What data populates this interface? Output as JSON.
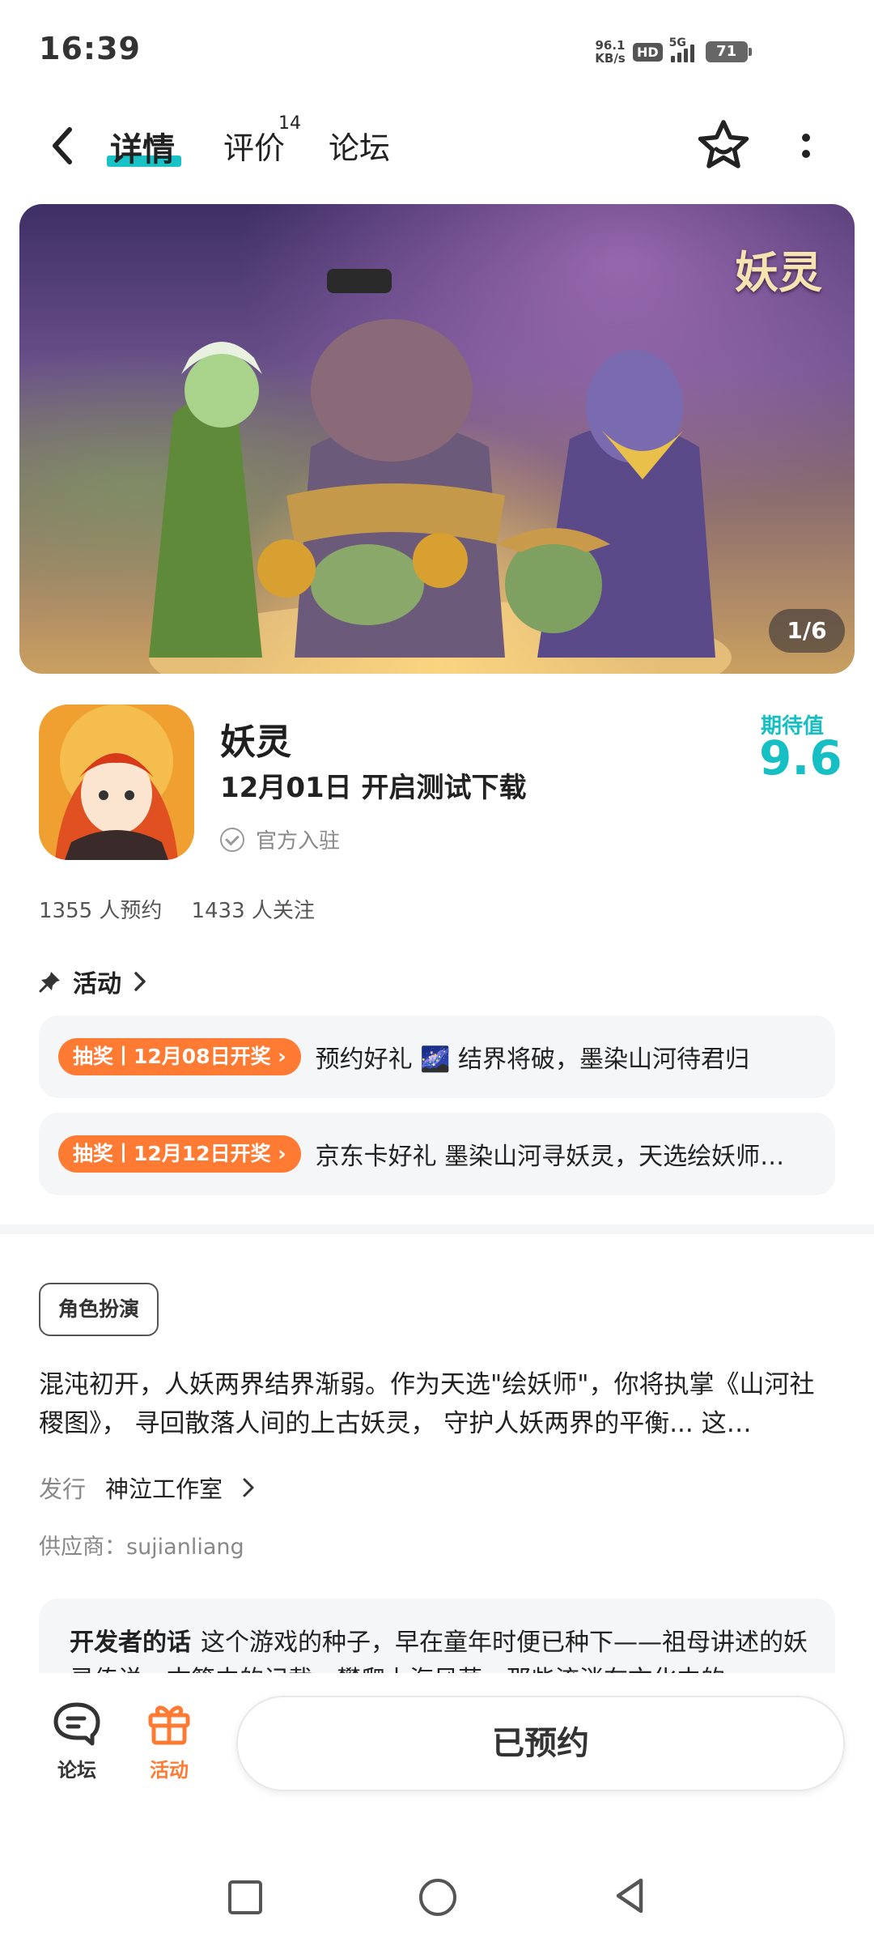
{
  "status_bar": {
    "time": "16:39",
    "net_speed_value": "96.1",
    "net_speed_unit": "KB/s",
    "hd": "HD",
    "network": "5G",
    "battery": "71"
  },
  "nav": {
    "tabs": [
      {
        "label": "详情",
        "active": true
      },
      {
        "label": "评价",
        "badge": "14"
      },
      {
        "label": "论坛"
      }
    ]
  },
  "hero": {
    "logo_text": "妖灵",
    "counter": "1/6"
  },
  "app": {
    "name": "妖灵",
    "date_text": "12月01日 开启测试下载",
    "official": "官方入驻",
    "expect_label": "期待值",
    "expect_score": "9.6",
    "reservations": "1355 人预约",
    "followers": "1433 人关注"
  },
  "activity": {
    "header": "活动",
    "items": [
      {
        "badge": "抽奖丨12月08日开奖",
        "text": "预约好礼 🌌 结界将破，墨染山河待君归"
      },
      {
        "badge": "抽奖丨12月12日开奖",
        "text": "京东卡好礼 墨染山河寻妖灵，天选绘妖师待君归"
      }
    ]
  },
  "detail": {
    "genre_tag": "角色扮演",
    "description": "混沌初开，人妖两界结界渐弱。作为天选\"绘妖师\"，你将执掌《山河社稷图》， 寻回散落人间的上古妖灵， 守护人妖两界的平衡... 这…",
    "publisher_label": "发行",
    "publisher_value": "神泣工作室",
    "supplier": "供应商：sujianliang",
    "dev_words_label": "开发者的话",
    "dev_words_text": "这个游戏的种子，早在童年时便已种下——祖母讲述的妖灵传说，古籍中的记载，攀爬上海风草，那些流淌在文化中的"
  },
  "bottom": {
    "forum_label": "论坛",
    "activity_label": "活动",
    "reserve_button": "已预约"
  },
  "colors": {
    "accent_teal": "#16bfc4",
    "accent_orange": "#ff7a33"
  }
}
